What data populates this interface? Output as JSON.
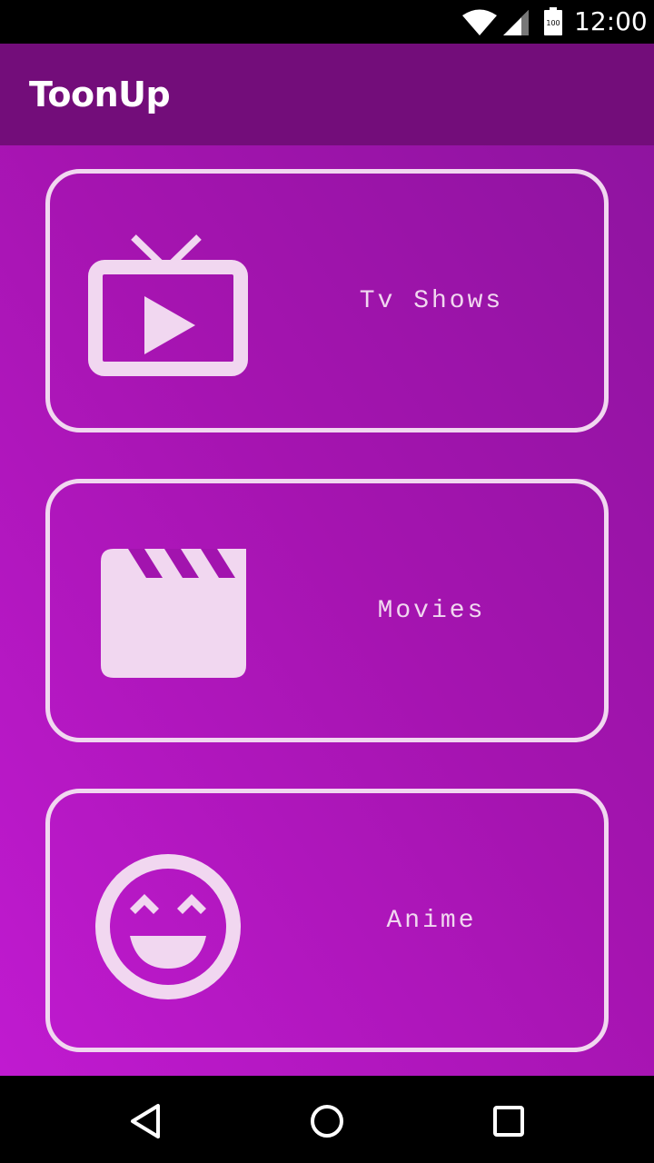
{
  "status_bar": {
    "time": "12:00",
    "battery_level": "100"
  },
  "app": {
    "title": "ToonUp"
  },
  "cards": [
    {
      "label": "Tv Shows",
      "icon": "tv-play-icon"
    },
    {
      "label": "Movies",
      "icon": "clapperboard-icon"
    },
    {
      "label": "Anime",
      "icon": "smiley-face-icon"
    }
  ],
  "colors": {
    "app_bar": "#730d7a",
    "content_top": "#8f14a0",
    "content_bottom": "#c01ad0",
    "card_outline": "#f1d7f0"
  },
  "nav_bar": [
    "back-icon",
    "home-icon",
    "recents-icon"
  ]
}
